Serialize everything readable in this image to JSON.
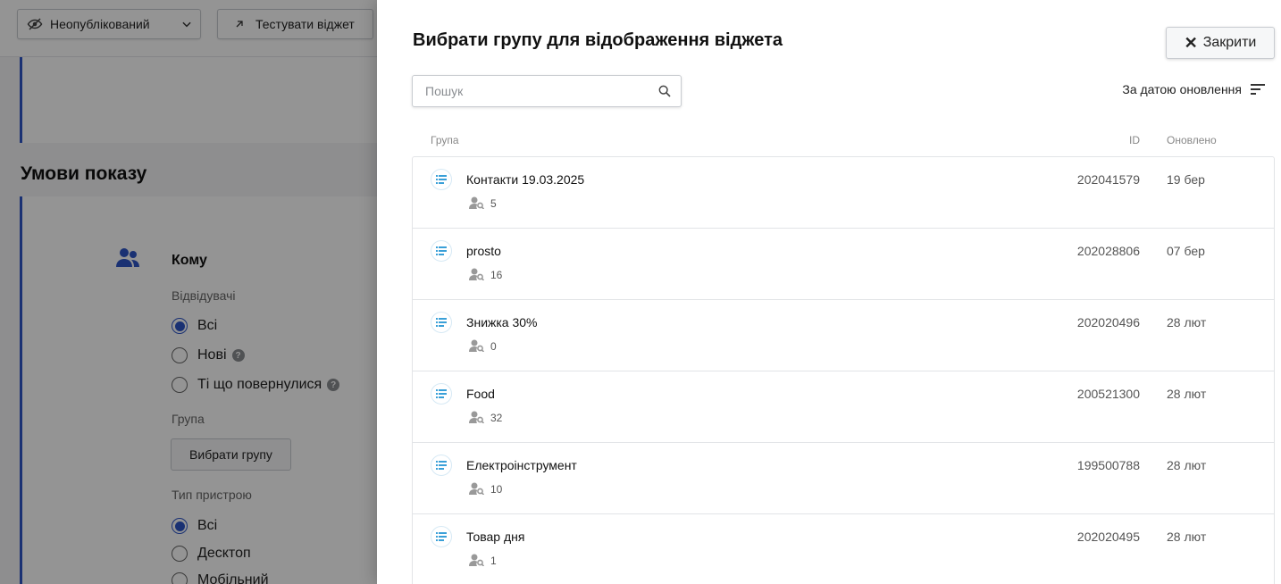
{
  "background": {
    "status_label": "Неопублікований",
    "test_label": "Тестувати віджет",
    "section_title": "Умови показу",
    "who_label": "Кому",
    "visitors_label": "Відвідувачі",
    "visitor_options": [
      "Всі",
      "Нові",
      "Ті що повернулися"
    ],
    "group_label": "Група",
    "pick_group_label": "Вибрати групу",
    "device_label": "Тип пристрою",
    "device_options": [
      "Всі",
      "Десктоп",
      "Мобільний"
    ]
  },
  "drawer": {
    "title": "Вибрати групу для відображення віджета",
    "close_label": "Закрити",
    "search_placeholder": "Пошук",
    "sort_label": "За датою оновлення",
    "columns": {
      "group": "Група",
      "id": "ID",
      "updated": "Оновлено"
    },
    "rows": [
      {
        "name": "Контакти 19.03.2025",
        "count": "5",
        "id": "202041579",
        "updated": "19 бер"
      },
      {
        "name": "prosto",
        "count": "16",
        "id": "202028806",
        "updated": "07 бер"
      },
      {
        "name": "Знижка 30%",
        "count": "0",
        "id": "202020496",
        "updated": "28 лют"
      },
      {
        "name": "Food",
        "count": "32",
        "id": "200521300",
        "updated": "28 лют"
      },
      {
        "name": "Електроінструмент",
        "count": "10",
        "id": "199500788",
        "updated": "28 лют"
      },
      {
        "name": "Товар дня",
        "count": "1",
        "id": "202020495",
        "updated": "28 лют"
      }
    ]
  },
  "colors": {
    "accent": "#2d55c7",
    "list_icon": "#3aa0d8"
  }
}
